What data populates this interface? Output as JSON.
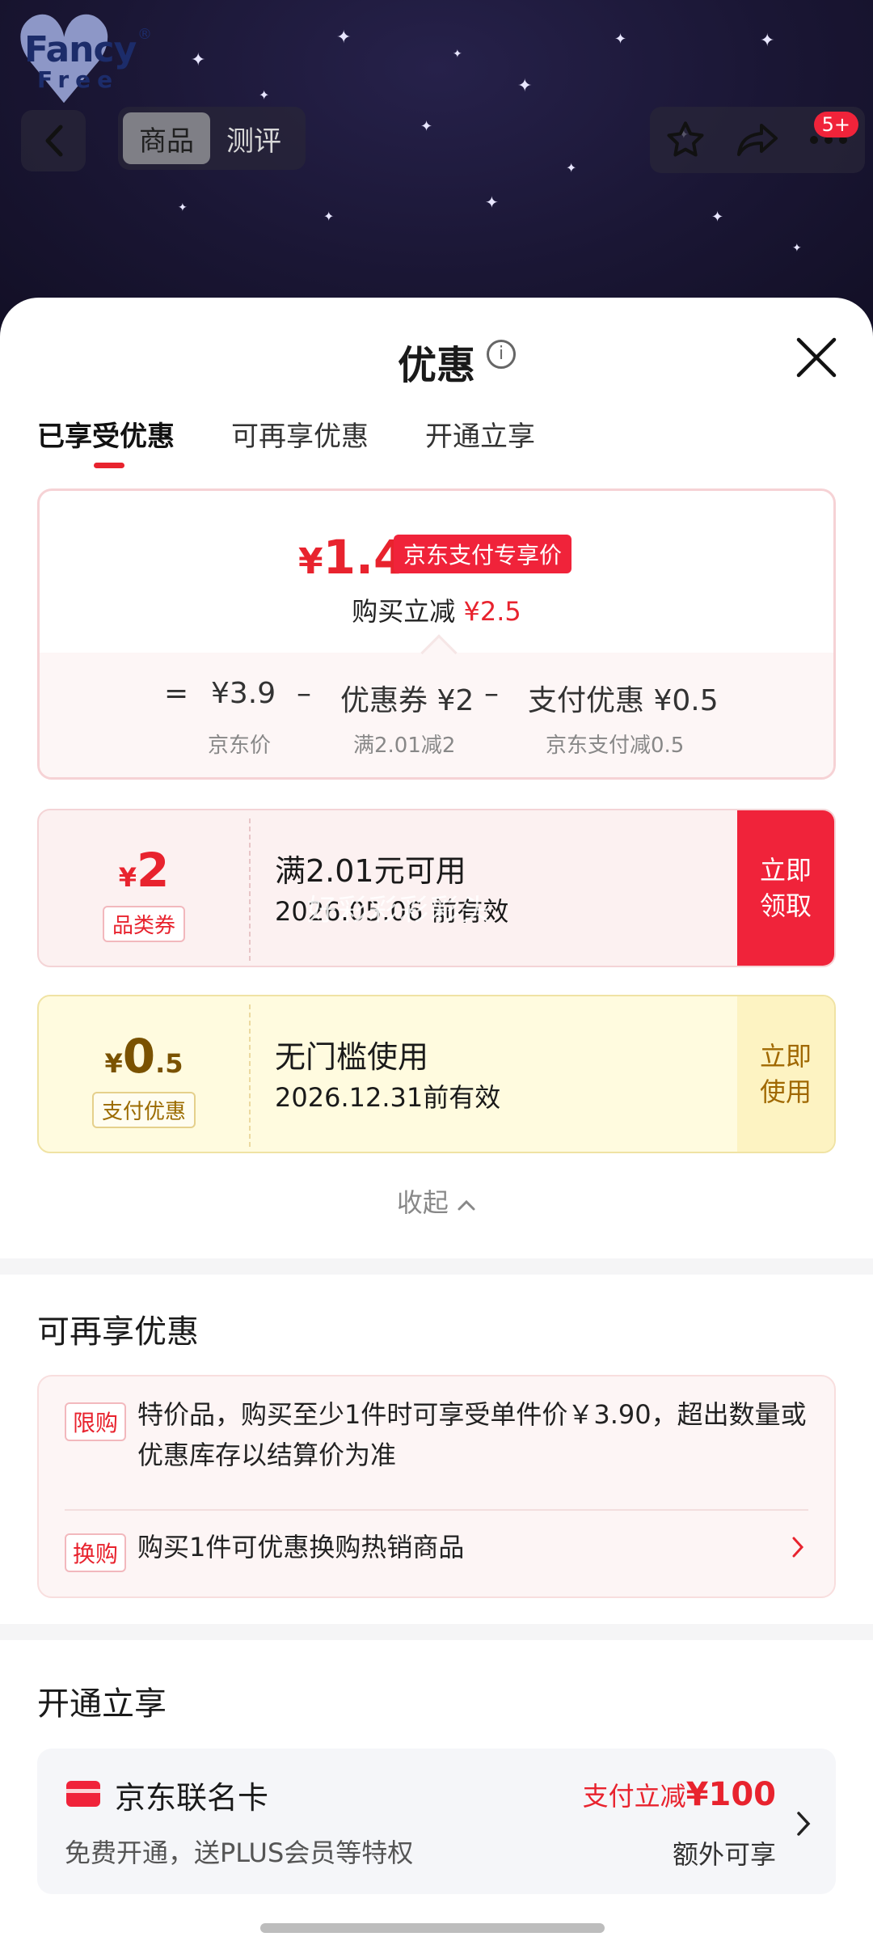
{
  "header": {
    "logo_top": "Fancy",
    "logo_bottom": "Free",
    "logo_reg": "®",
    "tabs": [
      "商品",
      "测评"
    ],
    "more_badge": "5+"
  },
  "sheet": {
    "title": "优惠",
    "info_icon": "i",
    "tabs": [
      "已享受优惠",
      "可再享优惠",
      "开通立享"
    ],
    "active_tab": 0
  },
  "summary": {
    "price_symbol": "¥",
    "price": "1.4",
    "price_tag": "京东支付专享价",
    "reduce_label": "购买立减",
    "reduce_amount": "¥2.5",
    "eq": "=",
    "minus": "–",
    "base_price": "¥3.9",
    "base_label": "京东价",
    "coupon_text": "优惠券 ¥2",
    "coupon_label": "满2.01减2",
    "pay_text": "支付优惠 ¥0.5",
    "pay_label": "京东支付减0.5"
  },
  "coupons": [
    {
      "symbol": "¥",
      "value": "2",
      "tag": "品类券",
      "condition": "满2.01元可用",
      "validity": "2026.05.06 前有效",
      "button": "立即\n领取"
    },
    {
      "symbol": "¥",
      "value": "0",
      "value_dec": ".5",
      "tag": "支付优惠",
      "condition": "无门槛使用",
      "validity": "2026.12.31前有效",
      "button": "立即\n使用"
    }
  ],
  "watermark": "好彩彩彩彩头",
  "collapse_label": "收起",
  "more_offers": {
    "title": "可再享优惠",
    "items": [
      {
        "label": "限购",
        "text": "特价品，购买至少1件时可享受单件价￥3.90，超出数量或优惠库存以结算价为准"
      },
      {
        "label": "换购",
        "text": "购买1件可优惠换购热销商品"
      }
    ]
  },
  "open_section": {
    "title": "开通立享",
    "card_name": "京东联名卡",
    "card_desc": "免费开通，送PLUS会员等特权",
    "offer_prefix": "支付立减",
    "offer_amount": "¥100",
    "offer_extra": "额外可享"
  },
  "colors": {
    "accent_red": "#f0233a",
    "price_red": "#e8232e",
    "gold": "#a06800"
  }
}
